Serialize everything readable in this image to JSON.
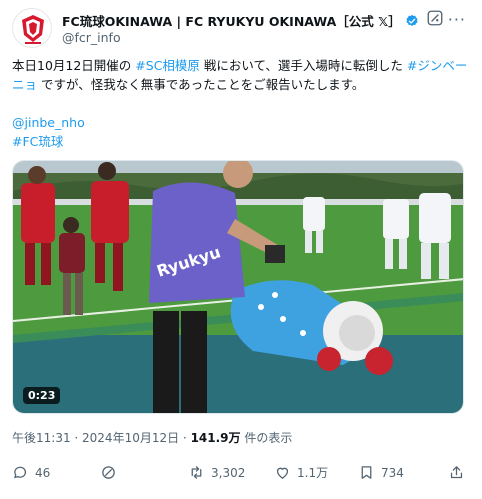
{
  "post": {
    "display_name": "FC琉球OKINAWA | FC RYUKYU OKINAWA［公式 𝕏］",
    "handle": "@fcr_info",
    "text_part1": "本日10月12日開催の ",
    "mention_sc": "#SC相模原",
    "text_part2": " 戦において、選手入場時に転倒した ",
    "mention_jinbe": "#ジンベーニョ",
    "text_part3": " ですが、怪我なく無事であったことをご報告いたします。",
    "link_user": "@jinbe_nho",
    "link_tag": "#FC琉球"
  },
  "media": {
    "duration": "0:23",
    "sign_text": "Ryukyu"
  },
  "meta": {
    "time_date": "午後11:31 · 2024年10月12日 · ",
    "views": "141.9万",
    "views_suffix": " 件の表示"
  },
  "actions": {
    "reply_count": "46",
    "repost_count": "3,302",
    "like_count": "1.1万",
    "bookmark_count": "734"
  },
  "colors": {
    "accent": "#1d9bf0",
    "pitch_green": "#3f8a3a",
    "mascot_blue": "#3fa2e0"
  }
}
